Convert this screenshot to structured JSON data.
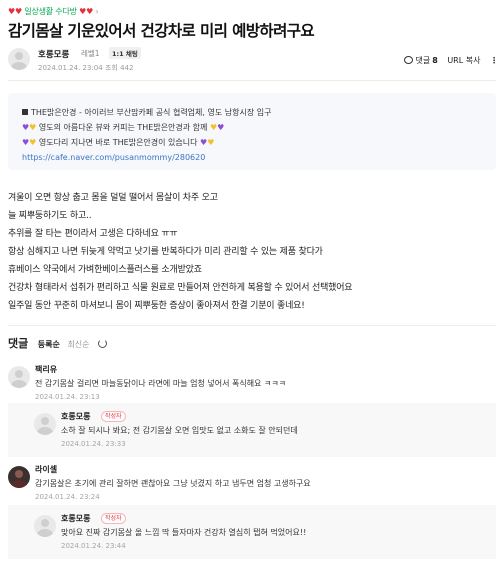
{
  "board": {
    "name": "일상생활 수다방"
  },
  "post": {
    "title": "감기몸살 기운있어서 건강차로 미리 예방하려구요",
    "author": "호롱모롱",
    "level": "레벨1",
    "chat_badge": "1:1 채팅",
    "date": "2024.01.24. 23:04",
    "views_label": "조회",
    "views": "442",
    "comment_label": "댓글",
    "comment_count": "8",
    "url_label": "URL 복사"
  },
  "quote": {
    "line1": "THE밝은안경 - 아이러브 부산맘카페 공식 협력업체, 영도 남항시장 입구",
    "line2": "영도의 아름다운 뷰와 커피는 THE밝은안경과 함께",
    "line3": "영도다리 지나면 바로 THE밝은안경이 있습니다",
    "link": "https://cafe.naver.com/pusanmommy/280620"
  },
  "body": [
    "겨울이 오면 항상 춥고 몸을 덜덜 떨어서 몸살이 차주 오고",
    "늘 찌뿌둥하기도 하고..",
    "추위를 잘 타는 편이라서 고생은 다하네요 ㅠㅠ",
    "항상 심해지고 나면 뒤늦게 약먹고 낫기를 반복하다가 미리 관리할 수 있는 제품 찾다가",
    " 휴베이스 약국에서 가벼한베이스플러스를 소개받았죠",
    "건강차 형태라서 섭취가 편리하고 식물 원료로 만들어져 안전하게 복용할 수 있어서 선택했어요",
    " 일주일 동안 꾸준히 마셔보니 몸이 찌뿌둥한 증상이 좋아져서 한결 기분이 좋네요!"
  ],
  "comments_header": {
    "label": "댓글",
    "sort_active": "등록순",
    "sort_other": "최신순"
  },
  "comments": [
    {
      "nick": "팩리유",
      "text": "전 감기몸살 걸리면 마늘동닭이나 라면에 마늘 엄청 넣어서 폭식해요 ㅋㅋㅋ",
      "time": "2024.01.24. 23:13"
    },
    {
      "nick": "호롱모롱",
      "badge": "작성자",
      "text": "소하 잘 되시나 봐요; 전 감기몸살 오면 입맛도 없고 소화도 잘 안되던데",
      "time": "2024.01.24. 23:33"
    },
    {
      "nick": "라이셀",
      "text": "감기몸살은 초기에 관리 잘하면 괜찮아요 그냥 넛겼지 하고 냅두면 엄청 고생하구요",
      "time": "2024.01.24. 23:24"
    },
    {
      "nick": "호롱모롱",
      "badge": "작성자",
      "text": "맞아요 진짜 감기몸살 올 느낌 딱 들자마자 건강차 열심히 탭혀 먹었어요!!",
      "time": "2024.01.24. 23:44"
    }
  ]
}
